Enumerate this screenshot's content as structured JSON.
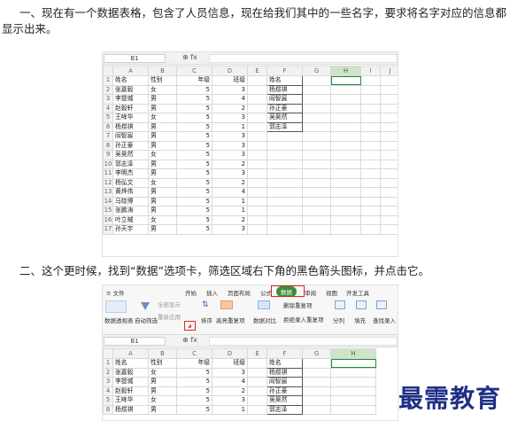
{
  "paragraphs": {
    "p1": "一、现在有一个数据表格，包含了人员信息，现在给我们其中的一些名字，要求将名字对应的信息都显示出来。",
    "p2": "二、这个更时候，找到“数据”选项卡，筛选区域右下角的黑色箭头图标，并点击它。"
  },
  "shot1": {
    "name_box": "B1",
    "fx_icons": "⊕ fx",
    "columns": [
      "",
      "A",
      "B",
      "C",
      "D",
      "E",
      "F",
      "G",
      "H",
      "I",
      "J"
    ],
    "header_row": [
      "姓名",
      "性别",
      "年级",
      "班级"
    ],
    "rows": [
      [
        "张嘉毅",
        "女",
        "5",
        "3"
      ],
      [
        "李提城",
        "男",
        "5",
        "4"
      ],
      [
        "赵毅轩",
        "男",
        "5",
        "2"
      ],
      [
        "王哞华",
        "女",
        "5",
        "3"
      ],
      [
        "杨煜祺",
        "男",
        "5",
        "1"
      ],
      [
        "阎智宸",
        "男",
        "5",
        "3"
      ],
      [
        "孙正豪",
        "男",
        "5",
        "3"
      ],
      [
        "吴昊然",
        "女",
        "5",
        "3"
      ],
      [
        "郭志泽",
        "男",
        "5",
        "2"
      ],
      [
        "李明杰",
        "男",
        "5",
        "3"
      ],
      [
        "杨弘文",
        "女",
        "5",
        "2"
      ],
      [
        "黄烨伟",
        "男",
        "5",
        "4"
      ],
      [
        "马晓博",
        "男",
        "5",
        "1"
      ],
      [
        "张鹏涛",
        "男",
        "5",
        "1"
      ],
      [
        "叶立械",
        "女",
        "5",
        "2"
      ],
      [
        "孙天宇",
        "男",
        "5",
        "3"
      ]
    ],
    "lookup_header": "姓名",
    "lookup_names": [
      "杨煜祺",
      "阎智宸",
      "孙正豪",
      "吴昊然",
      "郭志泽"
    ]
  },
  "shot2": {
    "tabs": [
      "≡ 文件",
      "开始",
      "插入",
      "页面布局",
      "公式",
      "数据",
      "审阅",
      "视图",
      "开发工具"
    ],
    "active_tab": "数据",
    "tools": [
      "数据透视表",
      "自动筛选",
      "全部显示",
      "重新应用",
      "排序",
      "高亮重复项",
      "数据对比",
      "删除重复项",
      "拒绝录入重复项",
      "分列",
      "填充",
      "查找录入"
    ],
    "name_box": "B1",
    "fx_icons": "⊕ fx",
    "columns": [
      "",
      "A",
      "B",
      "C",
      "D",
      "E",
      "F",
      "G",
      "H"
    ],
    "header_row": [
      "姓名",
      "性别",
      "年级",
      "班级"
    ],
    "rows": [
      [
        "张嘉毅",
        "女",
        "5",
        "3"
      ],
      [
        "李提城",
        "男",
        "5",
        "4"
      ],
      [
        "赵毅轩",
        "男",
        "5",
        "2"
      ],
      [
        "王哞华",
        "女",
        "5",
        "3"
      ],
      [
        "杨煜祺",
        "男",
        "5",
        "1"
      ]
    ],
    "lookup_header": "姓名",
    "lookup_names": [
      "杨煜祺",
      "阎智宸",
      "孙正豪",
      "吴昊然",
      "郭志泽"
    ]
  },
  "watermark": "最需教育"
}
